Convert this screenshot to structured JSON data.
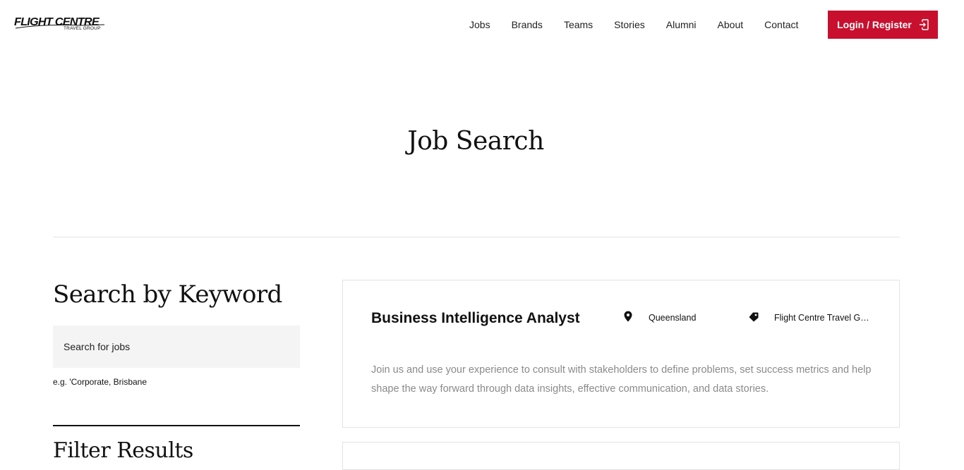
{
  "brand": {
    "logo_main": "FLIGHT CENTRE",
    "logo_sub": "TRAVEL GROUP"
  },
  "nav": {
    "items": [
      {
        "label": "Jobs"
      },
      {
        "label": "Brands"
      },
      {
        "label": "Teams"
      },
      {
        "label": "Stories"
      },
      {
        "label": "Alumni"
      },
      {
        "label": "About"
      },
      {
        "label": "Contact"
      }
    ],
    "login_label": "Login / Register",
    "login_icon": "login-door-icon"
  },
  "hero": {
    "title": "Job Search"
  },
  "sidebar": {
    "search_title": "Search by Keyword",
    "search_placeholder": "Search for jobs",
    "search_value": "",
    "search_hint": "e.g. 'Corporate, Brisbane",
    "filter_title": "Filter Results"
  },
  "jobs": [
    {
      "title": "Business Intelligence Analyst",
      "location": "Queensland",
      "location_icon": "map-pin-icon",
      "brand": "Flight Centre Travel Group",
      "brand_icon": "tag-icon",
      "description": "Join us and use your experience to consult with stakeholders to define problems, set success metrics and help shape the way forward through data insights, effective communication, and data stories."
    }
  ],
  "colors": {
    "accent": "#c8102e",
    "description_text": "#8a8a8a",
    "input_bg": "#f4f4f4",
    "border": "#e3e3e3"
  }
}
